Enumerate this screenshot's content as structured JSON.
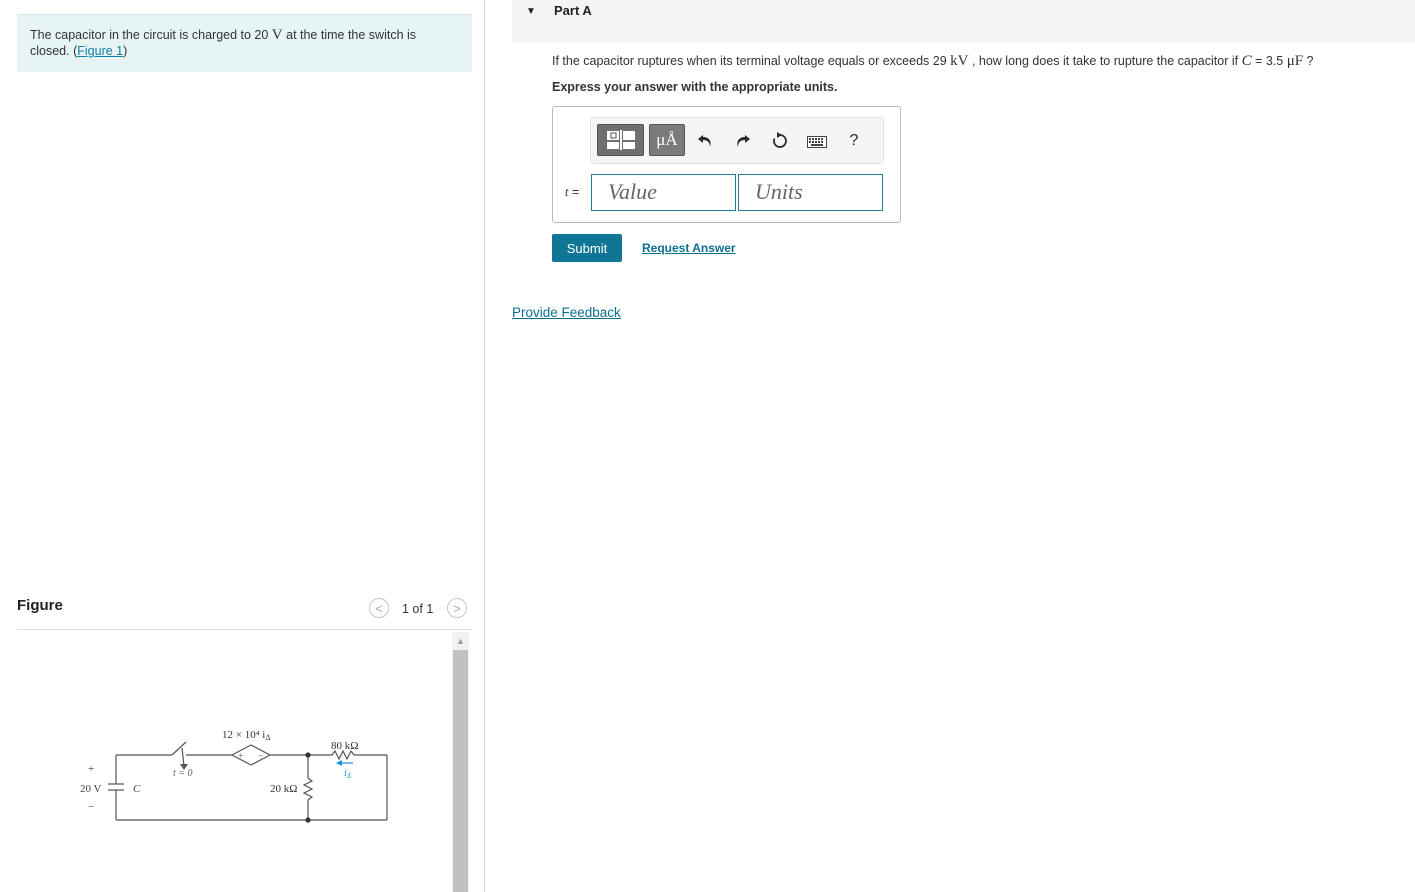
{
  "problem": {
    "intro_prefix": "The capacitor in the circuit is charged to 20 ",
    "intro_unit": "V",
    "intro_middle": " at the time the switch is closed. (",
    "figure_link": "Figure 1",
    "intro_suffix": ")"
  },
  "figure": {
    "title": "Figure",
    "pager": "1 of 1",
    "prev_glyph": "<",
    "next_glyph": ">",
    "circuit_labels": {
      "plus": "+",
      "minus": "−",
      "source": "20 V",
      "cap": "C",
      "switch": "t = 0",
      "dep_source": "12 × 10⁴ i",
      "dep_sub": "Δ",
      "dep_plus": "+",
      "dep_minus": "−",
      "r1": "80 kΩ",
      "r2": "20 kΩ",
      "current": "i",
      "current_sub": "Δ"
    },
    "colors": {
      "wire": "#555555",
      "current_arrow": "#1e90d8"
    }
  },
  "part": {
    "title": "Part A",
    "q_prefix": "If the capacitor ruptures when its terminal voltage equals or exceeds 29 ",
    "q_unit1": "kV",
    "q_middle": " , how long does it take to rupture the capacitor if ",
    "q_var": "C",
    "q_eq": " = 3.5 ",
    "q_unit2": "μF",
    "q_suffix": " ?",
    "instruction": "Express your answer with the appropriate units."
  },
  "toolbar": {
    "units_btn": "μÅ",
    "help": "?",
    "icons": [
      "templates-icon",
      "units-icon",
      "undo-icon",
      "redo-icon",
      "reset-icon",
      "keyboard-icon",
      "help-icon"
    ]
  },
  "answer": {
    "var_label": "t",
    "equals": " =",
    "value_placeholder": "Value",
    "units_placeholder": "Units"
  },
  "actions": {
    "submit": "Submit",
    "request": "Request Answer",
    "feedback": "Provide Feedback"
  },
  "colors": {
    "accent": "#0f7696",
    "intro_bg": "#e7f4f6",
    "link": "#0d6f8f"
  }
}
